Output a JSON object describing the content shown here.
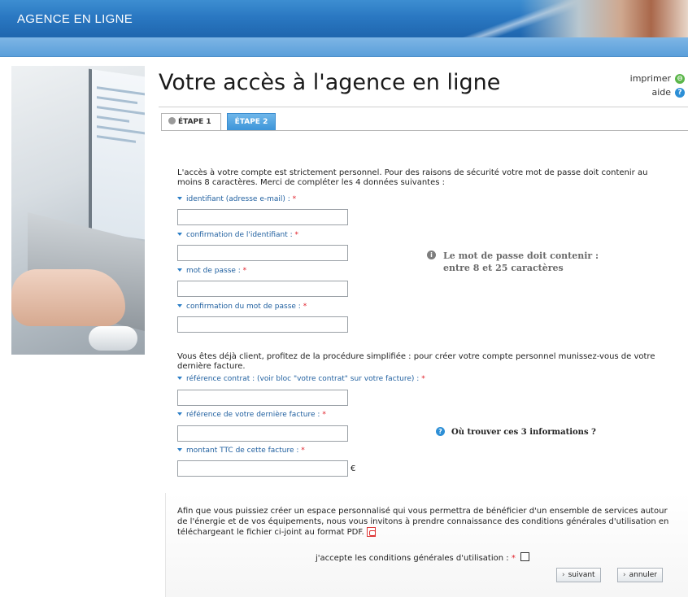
{
  "header": {
    "brand": "AGENCE EN LIGNE"
  },
  "page": {
    "title": "Votre accès à l'agence en ligne",
    "tools": {
      "print_label": "imprimer",
      "help_label": "aide",
      "print_icon": "print-icon",
      "help_icon": "help-icon"
    }
  },
  "tabs": [
    {
      "label": "ÉTAPE 1",
      "active": true
    },
    {
      "label": "ÉTAPE 2",
      "active": false
    }
  ],
  "intro": {
    "line1": "L'accès à votre compte est strictement personnel. Pour des raisons de sécurité votre mot de passe doit contenir au",
    "line2": "moins 8 caractères. Merci de compléter les 4 données suivantes :"
  },
  "fields": {
    "identifiant": {
      "label": "identifiant (adresse e-mail) : ",
      "value": ""
    },
    "confirm_identifiant": {
      "label": "confirmation de l'identifiant : ",
      "value": ""
    },
    "mot_de_passe": {
      "label": "mot de passe : ",
      "value": ""
    },
    "confirm_mot_de_passe": {
      "label": "confirmation du mot de passe : ",
      "value": ""
    },
    "reference_contrat": {
      "label": "référence contrat : (voir bloc \"votre contrat\" sur votre facture) : ",
      "value": ""
    },
    "reference_facture": {
      "label": "référence de votre dernière facture : ",
      "value": ""
    },
    "montant_ttc": {
      "label": "montant TTC de cette facture : ",
      "value": "",
      "unit": "€"
    }
  },
  "required_marker": "*",
  "password_note": {
    "line1": "Le mot de passe doit contenir :",
    "line2": "entre 8 et 25 caractères"
  },
  "client_intro": {
    "line1": "Vous êtes déjà client, profitez de la procédure simplifiée : pour créer votre compte personnel munissez-vous de votre",
    "line2": "dernière facture."
  },
  "help_link": "Où trouver ces 3 informations ?",
  "conditions": {
    "line1": "Afin que vous puissiez créer un espace personnalisé qui vous permettra de bénéficier d'un ensemble de services autour",
    "line2": "de l'énergie et de vos équipements, nous vous invitons à prendre connaissance des conditions générales d'utilisation en",
    "line3": "téléchargeant le fichier ci-joint au format PDF.",
    "accept_label": "j'accepte les conditions générales d'utilisation : ",
    "accepted": false
  },
  "buttons": {
    "next": "suivant",
    "cancel": "annuler"
  }
}
